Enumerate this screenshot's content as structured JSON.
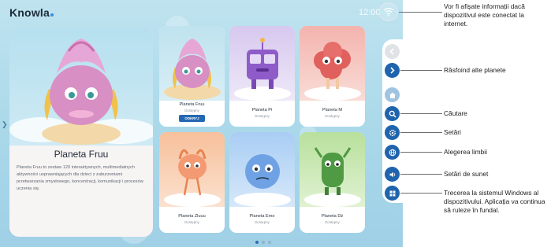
{
  "app": {
    "logo": "Knowla",
    "clock": "12:00"
  },
  "featured": {
    "title": "Planeta Fruu",
    "description": "Planeta Fruu to zestaw 120 interaktywnych, multimedialnych aktywności usprawniających dla dzieci z zaburzeniami przetwarzania zmysłowego, koncentracji, komunikacji i procesów uczenia się."
  },
  "cards": [
    {
      "name": "Planeta Fruu",
      "status": "Dostępny",
      "button": "ODKRYJ",
      "accent": "#d9a8d8"
    },
    {
      "name": "Planeta Pi",
      "status": "Dostępny",
      "accent": "#c9b6ea"
    },
    {
      "name": "Planeta M",
      "status": "Dostępny",
      "accent": "#f1a09e"
    },
    {
      "name": "Planeta Zluuu",
      "status": "Dostępny",
      "accent": "#f6b68f"
    },
    {
      "name": "Planeta Emo",
      "status": "Dostępny",
      "accent": "#9ec2ef"
    },
    {
      "name": "Planeta Dź",
      "status": "Dostępny",
      "accent": "#a9d98b"
    }
  ],
  "pagination": {
    "pages": 3,
    "current": 1
  },
  "colors": {
    "rail_blue": "#1f64ad",
    "screen_bg": "#a9d8e9"
  },
  "callouts": [
    {
      "icon": "wifi-icon",
      "text": "Vor fi afișate informații dacă dispozitivul este conectat la internet."
    },
    {
      "icon": "chevron-right-icon",
      "text": "Răsfoind alte planete"
    },
    {
      "icon": "search-icon",
      "text": "Căutare"
    },
    {
      "icon": "gear-icon",
      "text": "Setări"
    },
    {
      "icon": "globe-icon",
      "text": "Alegerea limbii"
    },
    {
      "icon": "speaker-icon",
      "text": "Setări de sunet"
    },
    {
      "icon": "windows-icon",
      "text": "Trecerea la sistemul Windows al dispozitivului. Aplicația va continua să ruleze în fundal."
    }
  ]
}
